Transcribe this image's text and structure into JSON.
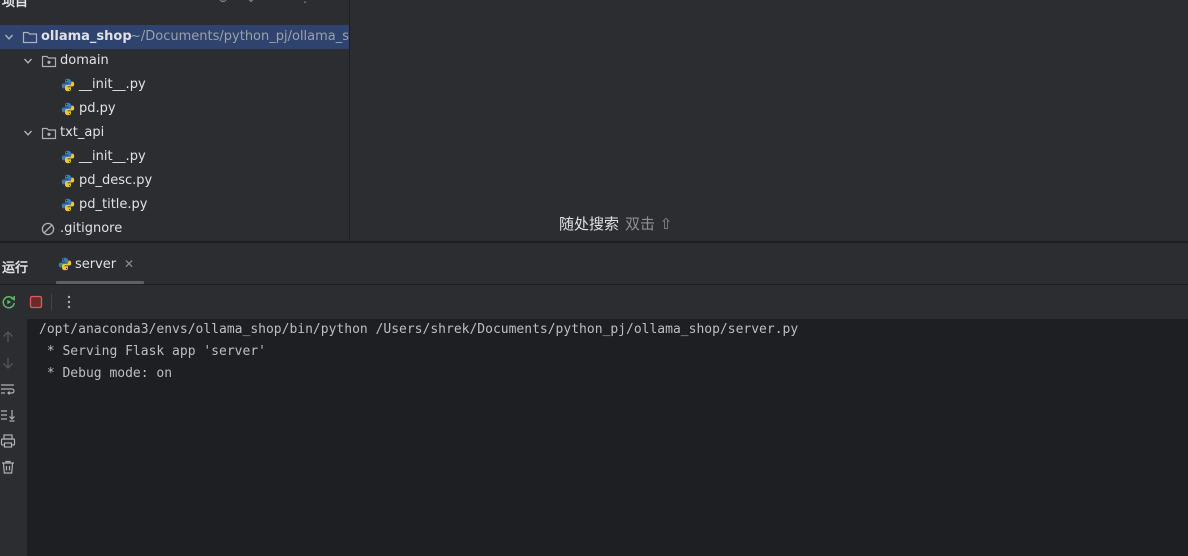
{
  "project_panel": {
    "title": "项目",
    "tree": {
      "root": {
        "name": "ollama_shop",
        "path": "~/Documents/python_pj/ollama_shop"
      },
      "items": [
        {
          "name": "domain"
        },
        {
          "name": "__init__.py"
        },
        {
          "name": "pd.py"
        },
        {
          "name": "txt_api"
        },
        {
          "name": "__init__.py"
        },
        {
          "name": "pd_desc.py"
        },
        {
          "name": "pd_title.py"
        },
        {
          "name": ".gitignore"
        }
      ]
    }
  },
  "editor": {
    "search_hint": {
      "label": "随处搜索",
      "shortcut": "双击 ⇧"
    }
  },
  "run_window": {
    "title": "运行",
    "tab": {
      "label": "server"
    },
    "console_lines": [
      "/opt/anaconda3/envs/ollama_shop/bin/python /Users/shrek/Documents/python_pj/ollama_shop/server.py",
      " * Serving Flask app 'server'",
      " * Debug mode: on"
    ]
  },
  "colors": {
    "accent_selection": "#2e436e",
    "stop_red": "#db5c5c",
    "rerun_green": "#5fb865",
    "python_blue": "#3d7ab8",
    "python_yellow": "#f0c33c"
  }
}
